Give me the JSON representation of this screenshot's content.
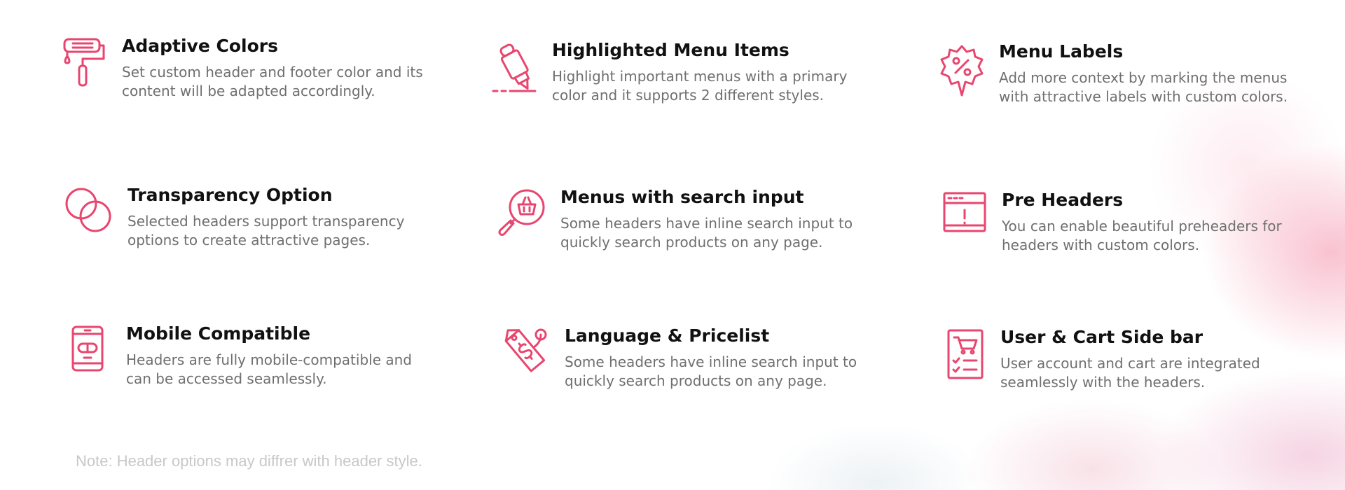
{
  "accent_color": "#e8466f",
  "features": [
    {
      "icon": "paint-roller-icon",
      "title": "Adaptive Colors",
      "description": "Set custom header and footer color and its\ncontent will be adapted accordingly."
    },
    {
      "icon": "highlighter-icon",
      "title": "Highlighted Menu Items",
      "description": "Highlight important menus with a primary\ncolor and it supports 2 different styles."
    },
    {
      "icon": "percent-badge-icon",
      "title": "Menu Labels",
      "description": "Add more context by marking the menus\nwith attractive labels with custom colors."
    },
    {
      "icon": "overlapping-circles-icon",
      "title": "Transparency Option",
      "description": "Selected headers support transparency\noptions to create attractive pages."
    },
    {
      "icon": "search-basket-icon",
      "title": "Menus with search input",
      "description": "Some headers have inline search input to\nquickly search products on any page."
    },
    {
      "icon": "browser-alert-icon",
      "title": "Pre Headers",
      "description": "You can enable beautiful preheaders for\nheaders with custom colors."
    },
    {
      "icon": "mobile-phone-icon",
      "title": "Mobile Compatible",
      "description": "Headers are fully mobile-compatible and\ncan be accessed seamlessly."
    },
    {
      "icon": "price-tag-icon",
      "title": "Language & Pricelist",
      "description": "Some headers have inline search input to\nquickly search products on any page."
    },
    {
      "icon": "cart-checklist-icon",
      "title": "User & Cart Side bar",
      "description": "User account and cart are integrated\nseamlessly with the headers."
    }
  ],
  "note": "Note: Header options may diffrer with header style."
}
